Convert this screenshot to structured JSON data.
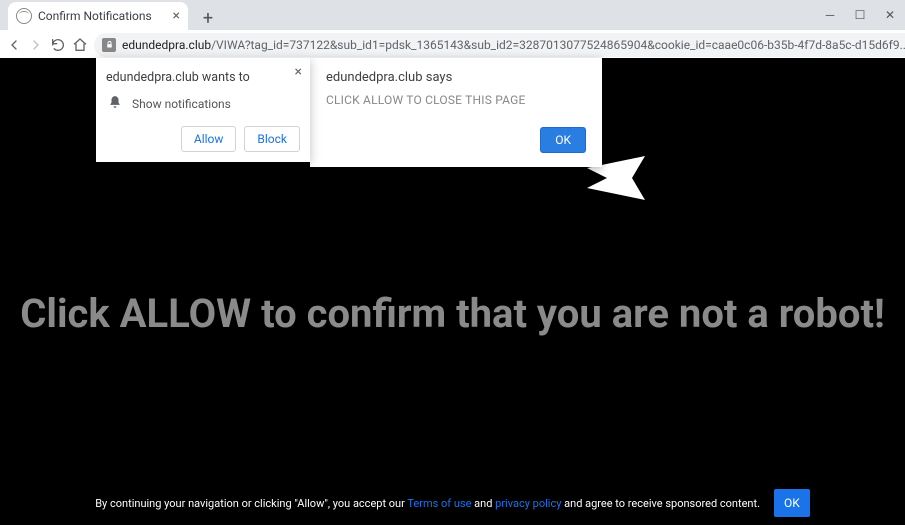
{
  "window": {
    "tab_title": "Confirm Notifications",
    "url_domain": "edundedpra.club",
    "url_path": "/VIWA?tag_id=737122&sub_id1=pdsk_1365143&sub_id2=3287013077524865904&cookie_id=caae0c06-b35b-4f7d-8a5c-d15d6f9..."
  },
  "notif_prompt": {
    "title": "edundedpra.club wants to",
    "permission": "Show notifications",
    "allow_label": "Allow",
    "block_label": "Block"
  },
  "alert": {
    "title": "edundedpra.club says",
    "message": "CLICK ALLOW TO CLOSE THIS PAGE",
    "ok_label": "OK"
  },
  "page": {
    "main_text": "Click ALLOW to confirm that you are not a robot!",
    "footer_prefix": "By continuing your navigation or clicking \"Allow\", you accept our ",
    "terms_link": "Terms of use",
    "and_text": " and ",
    "privacy_link": "privacy policy",
    "footer_suffix": " and agree to receive sponsored content.",
    "footer_ok": "OK"
  }
}
